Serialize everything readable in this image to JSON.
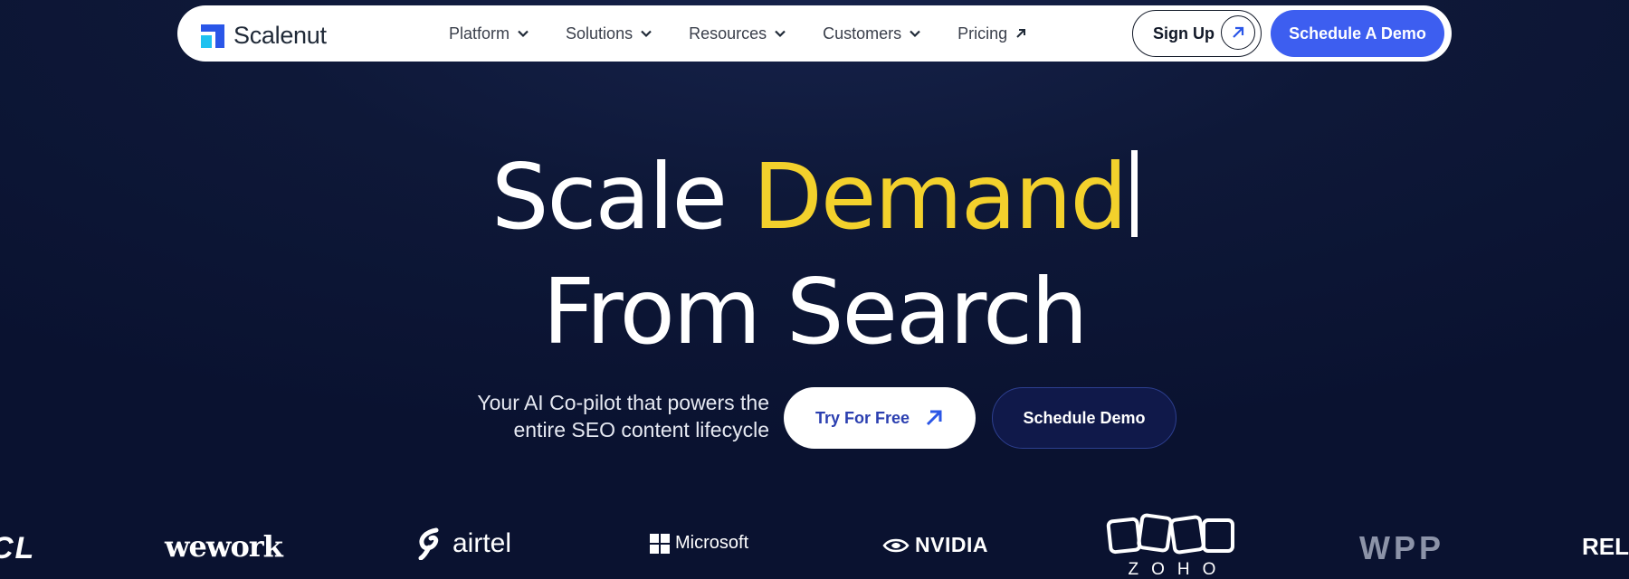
{
  "colors": {
    "background": "#0b1330",
    "accent_blue": "#3d5ef0",
    "highlight_yellow": "#f3d12c",
    "logo_blue": "#2a56e8",
    "logo_cyan": "#1ec1f0"
  },
  "navbar": {
    "brand": "Scalenut",
    "links": [
      {
        "label": "Platform",
        "icon": "chevron-down-icon"
      },
      {
        "label": "Solutions",
        "icon": "chevron-down-icon"
      },
      {
        "label": "Resources",
        "icon": "chevron-down-icon"
      },
      {
        "label": "Customers",
        "icon": "chevron-down-icon"
      },
      {
        "label": "Pricing",
        "icon": "arrow-up-right-icon"
      }
    ],
    "signup_label": "Sign Up",
    "demo_label": "Schedule A Demo"
  },
  "hero": {
    "title_part1": "Scale ",
    "title_highlight": "Demand",
    "title_line2": "From Search",
    "subtitle_line1": "Your AI Co-pilot that powers the",
    "subtitle_line2": "entire SEO content lifecycle",
    "try_label": "Try For Free",
    "schedule_label": "Schedule Demo"
  },
  "customer_logos": {
    "tcl": "CL",
    "wework": "wework",
    "airtel": "airtel",
    "microsoft": "Microsoft",
    "nvidia": "NVIDIA",
    "zoho": "ZOHO",
    "wpp": "WPP",
    "rel": "REL"
  }
}
